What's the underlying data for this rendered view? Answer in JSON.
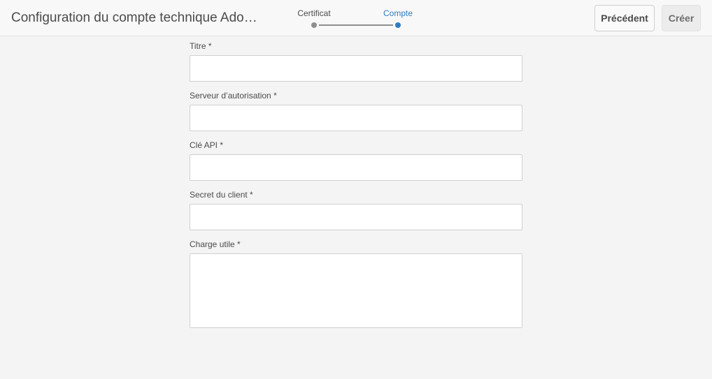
{
  "header": {
    "title": "Configuration du compte technique Adobe I...",
    "wizard": {
      "steps": [
        {
          "label": "Certificat",
          "state": "done"
        },
        {
          "label": "Compte",
          "state": "active"
        }
      ]
    },
    "buttons": {
      "previous_label": "Précédent",
      "create_label": "Créer"
    }
  },
  "form": {
    "fields": [
      {
        "label": "Titre *",
        "value": "",
        "type": "input"
      },
      {
        "label": "Serveur d’autorisation *",
        "value": "",
        "type": "input"
      },
      {
        "label": "Clé API *",
        "value": "",
        "type": "input"
      },
      {
        "label": "Secret du client *",
        "value": "",
        "type": "input"
      },
      {
        "label": "Charge utile *",
        "value": "",
        "type": "textarea"
      }
    ]
  },
  "colors": {
    "accent": "#2d7dc1",
    "step_done": "#8e8e8e",
    "background": "#f4f4f4",
    "header_background": "#f8f8f8"
  }
}
